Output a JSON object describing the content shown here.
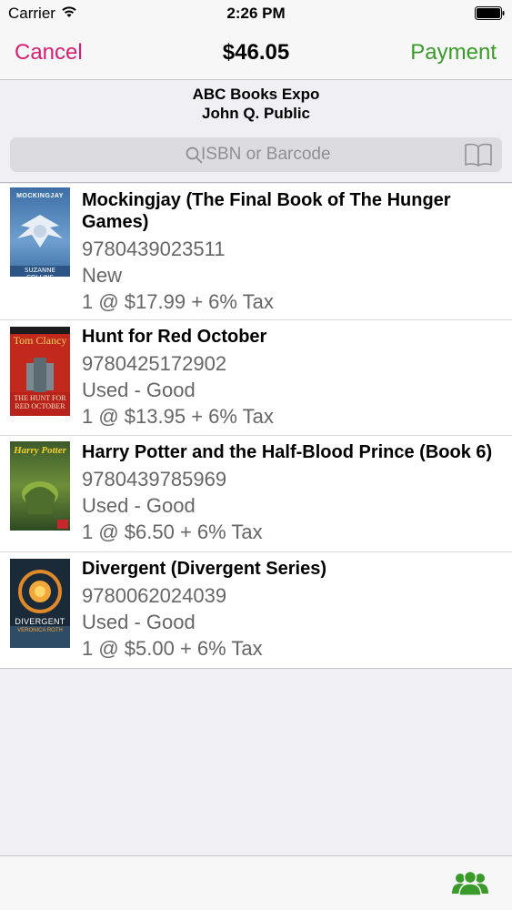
{
  "status_bar": {
    "carrier": "Carrier",
    "time": "2:26 PM",
    "wifi_icon": "wifi-icon",
    "battery_icon": "battery-icon"
  },
  "nav": {
    "cancel_label": "Cancel",
    "total": "$46.05",
    "payment_label": "Payment",
    "cancel_color": "#d41f75",
    "payment_color": "#3a9a2a"
  },
  "header": {
    "event_name": "ABC Books Expo",
    "customer_name": "John Q. Public"
  },
  "search": {
    "placeholder": "ISBN or Barcode",
    "value": "",
    "icons": [
      "search-icon",
      "book-icon"
    ]
  },
  "items": [
    {
      "title": "Mockingjay (The Final Book of The Hunger Games)",
      "isbn": "9780439023511",
      "condition": "New",
      "price_line": "1 @ $17.99 + 6% Tax",
      "cover": {
        "author_text": "SUZANNE COLLINS",
        "title_text": "MOCKINGJAY"
      }
    },
    {
      "title": "Hunt for Red October",
      "isbn": "9780425172902",
      "condition": "Used - Good",
      "price_line": "1 @ $13.95 + 6% Tax",
      "cover": {
        "author_text": "Tom Clancy",
        "title_text": "THE HUNT FOR RED OCTOBER"
      }
    },
    {
      "title": "Harry Potter and the Half-Blood Prince (Book 6)",
      "isbn": "9780439785969",
      "condition": "Used - Good",
      "price_line": "1 @ $6.50 + 6% Tax",
      "cover": {
        "title_text": "Harry Potter"
      }
    },
    {
      "title": "Divergent (Divergent Series)",
      "isbn": "9780062024039",
      "condition": "Used - Good",
      "price_line": "1 @ $5.00 + 6% Tax",
      "cover": {
        "title_text": "DIVERGENT",
        "author_text": "VERONICA ROTH"
      }
    }
  ],
  "toolbar": {
    "icon": "customers-icon",
    "icon_color": "#3a9a2a"
  }
}
